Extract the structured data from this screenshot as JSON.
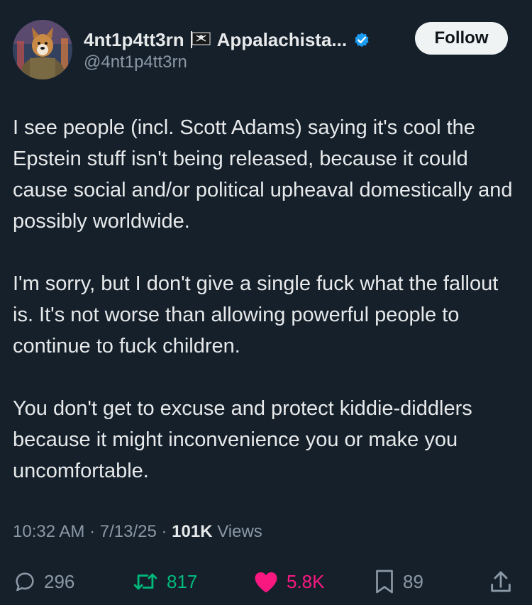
{
  "header": {
    "display_name": "4nt1p4tt3rn",
    "display_name_suffix": "Appalachista...",
    "handle": "@4nt1p4tt3rn",
    "follow_label": "Follow"
  },
  "tweet": {
    "paragraphs": [
      "I see people (incl. Scott Adams) saying it's cool the Epstein stuff isn't being released, because it could cause social and/or political upheaval domestically and possibly worldwide.",
      "I'm sorry, but I don't give a single fuck what the fallout is. It's not worse than allowing powerful people to continue to fuck children.",
      "You don't get to excuse and protect kiddie-diddlers because it might inconvenience you or make you uncomfortable."
    ]
  },
  "meta": {
    "time": "10:32 AM",
    "separator": "·",
    "date": "7/13/25",
    "views_count": "101K",
    "views_label": "Views"
  },
  "actions": {
    "replies": "296",
    "retweets": "817",
    "likes": "5.8K",
    "bookmarks": "89"
  },
  "colors": {
    "background": "#15202b",
    "text": "#e7e9ea",
    "muted": "#8b98a5",
    "retweet": "#00ba7c",
    "like": "#f91880",
    "verified": "#1d9bf0"
  },
  "icons": [
    "flag-icon",
    "verified-icon",
    "reply-icon",
    "retweet-icon",
    "like-icon",
    "bookmark-icon",
    "share-icon"
  ]
}
